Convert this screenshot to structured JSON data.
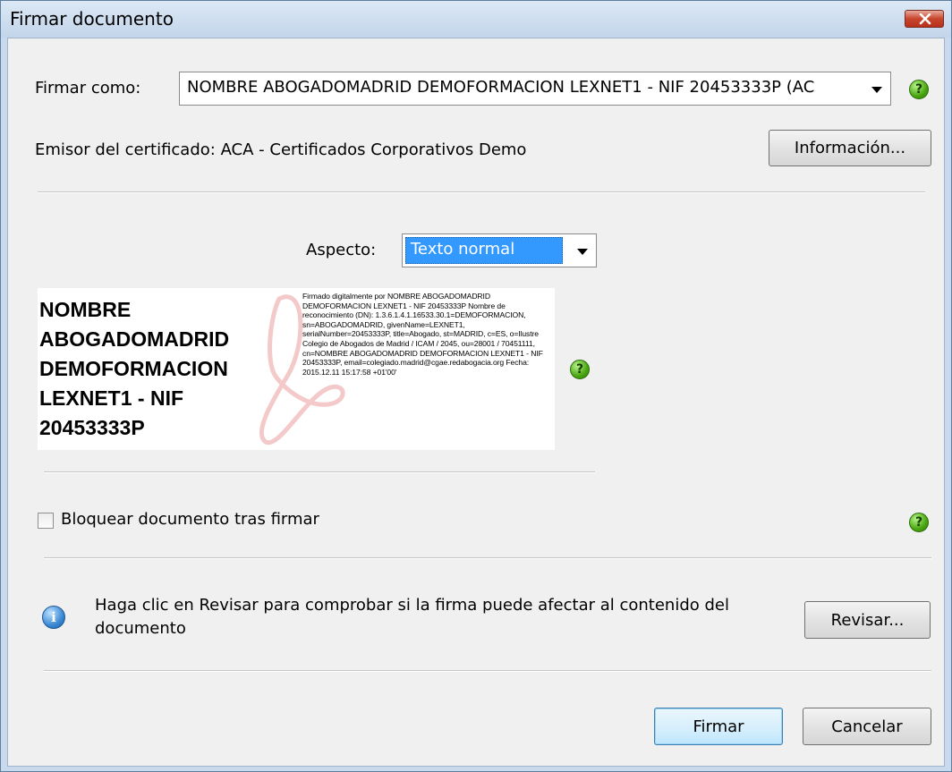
{
  "window": {
    "title": "Firmar documento"
  },
  "sign_as": {
    "label": "Firmar como:",
    "value": "NOMBRE ABOGADOMADRID DEMOFORMACION LEXNET1 - NIF 20453333P (AC"
  },
  "issuer": {
    "text": "Emisor del certificado: ACA - Certificados Corporativos Demo",
    "info_button": "Información..."
  },
  "appearance": {
    "label": "Aspecto:",
    "value": "Texto normal"
  },
  "signature_preview": {
    "name": "NOMBRE\nABOGADOMADRID\nDEMOFORMACION\nLEXNET1 - NIF\n20453333P",
    "details": "Firmado digitalmente por NOMBRE ABOGADOMADRID DEMOFORMACION LEXNET1 - NIF 20453333P Nombre de reconocimiento (DN): 1.3.6.1.4.1.16533.30.1=DEMOFORMACION, sn=ABOGADOMADRID, givenName=LEXNET1, serialNumber=20453333P, title=Abogado, st=MADRID, c=ES, o=Ilustre Colegio de Abogados de Madrid / ICAM / 2045, ou=28001 / 70451111, cn=NOMBRE ABOGADOMADRID DEMOFORMACION LEXNET1 - NIF 20453333P, email=colegiado.madrid@cgae.redabogacia.org Fecha: 2015.12.11 15:17:58 +01'00'"
  },
  "lock": {
    "label": "Bloquear documento tras firmar",
    "checked": false
  },
  "review": {
    "message": "Haga clic en Revisar para comprobar si la firma puede afectar al contenido del documento",
    "button": "Revisar..."
  },
  "actions": {
    "sign": "Firmar",
    "cancel": "Cancelar"
  },
  "icons": {
    "help": "help-icon",
    "info": "info-icon",
    "close": "close-icon"
  },
  "colors": {
    "selection": "#3399ff",
    "help_green": "#4aa510",
    "info_blue": "#3b89d4",
    "close_red": "#c8452d"
  }
}
